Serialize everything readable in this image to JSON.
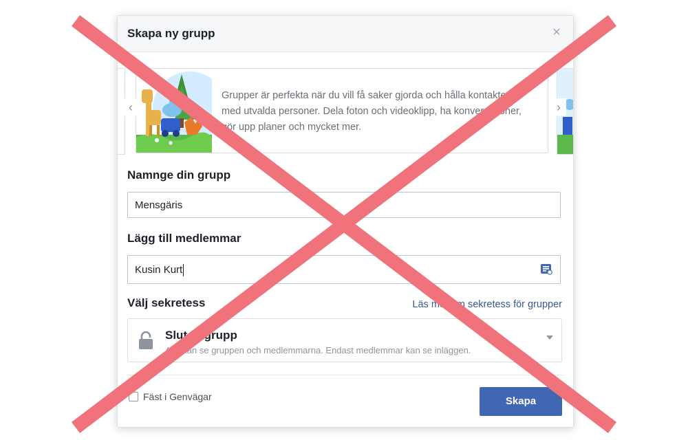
{
  "dialog": {
    "title": "Skapa ny grupp",
    "close_icon": "close-icon"
  },
  "carousel": {
    "description": "Grupper är perfekta när du vill få saker gjorda och hålla kontakten med utvalda personer. Dela foton och videoklipp, ha konversationer, gör upp planer och mycket mer.",
    "prev_icon": "chevron-left-icon",
    "next_icon": "chevron-right-icon"
  },
  "name_section": {
    "label": "Namnge din grupp",
    "value": "Mensgäris"
  },
  "members_section": {
    "label": "Lägg till medlemmar",
    "value": "Kusin Kurt",
    "icon": "contacts-icon"
  },
  "privacy_section": {
    "label": "Välj sekretess",
    "link": "Läs mer om sekretess för grupper",
    "selected_title": "Sluten grupp",
    "selected_desc": "Alla kan se gruppen och medlemmarna. Endast medlemmar kan se inläggen.",
    "icon": "lock-icon"
  },
  "footer": {
    "pin_label": "Fäst i Genvägar",
    "pin_checked": false,
    "create_label": "Skapa"
  },
  "colors": {
    "accent": "#4267b2",
    "link": "#365899",
    "cross": "#f0727a"
  }
}
